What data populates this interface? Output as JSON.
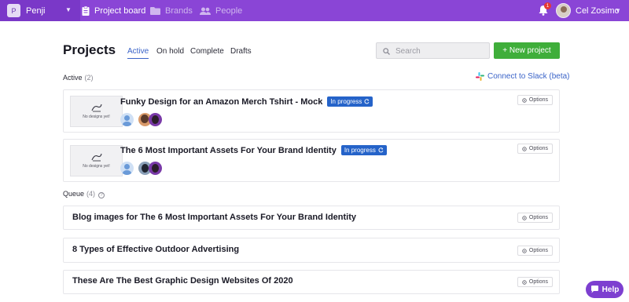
{
  "nav": {
    "workspace_initial": "P",
    "workspace_name": "Penji",
    "links": [
      {
        "label": "Project board",
        "icon": "clipboard-icon"
      },
      {
        "label": "Brands",
        "icon": "folder-icon"
      },
      {
        "label": "People",
        "icon": "people-icon"
      }
    ],
    "notification_count": "1",
    "user_name": "Cel Zosimo"
  },
  "header": {
    "title": "Projects",
    "tabs": [
      "Active",
      "On hold",
      "Complete",
      "Drafts"
    ],
    "active_tab": "Active",
    "search_placeholder": "Search",
    "new_project_label": "+ New project",
    "slack_link": "Connect to Slack (beta)"
  },
  "active_section": {
    "label": "Active",
    "count": "(2)",
    "projects": [
      {
        "title": "Funky Design for an Amazon Merch Tshirt - Mock",
        "status": "In progress",
        "thumb_text": "No designs yet!",
        "options_label": "Options"
      },
      {
        "title": "The 6 Most Important Assets For Your Brand Identity",
        "status": "In progress",
        "thumb_text": "No designs yet!",
        "options_label": "Options"
      }
    ]
  },
  "queue_section": {
    "label": "Queue",
    "count": "(4)",
    "projects": [
      {
        "title": "Blog images for The 6 Most Important Assets For Your Brand Identity",
        "options_label": "Options"
      },
      {
        "title": "8 Types of Effective Outdoor Advertising",
        "options_label": "Options"
      },
      {
        "title": "These Are The Best Graphic Design Websites Of 2020",
        "options_label": "Options"
      }
    ]
  },
  "help_label": "Help",
  "colors": {
    "nav_bg": "#8a45d6",
    "primary_green": "#3fae3a",
    "link_blue": "#3a63c8",
    "badge_blue": "#2563c9",
    "help_purple": "#7d3fd0"
  }
}
